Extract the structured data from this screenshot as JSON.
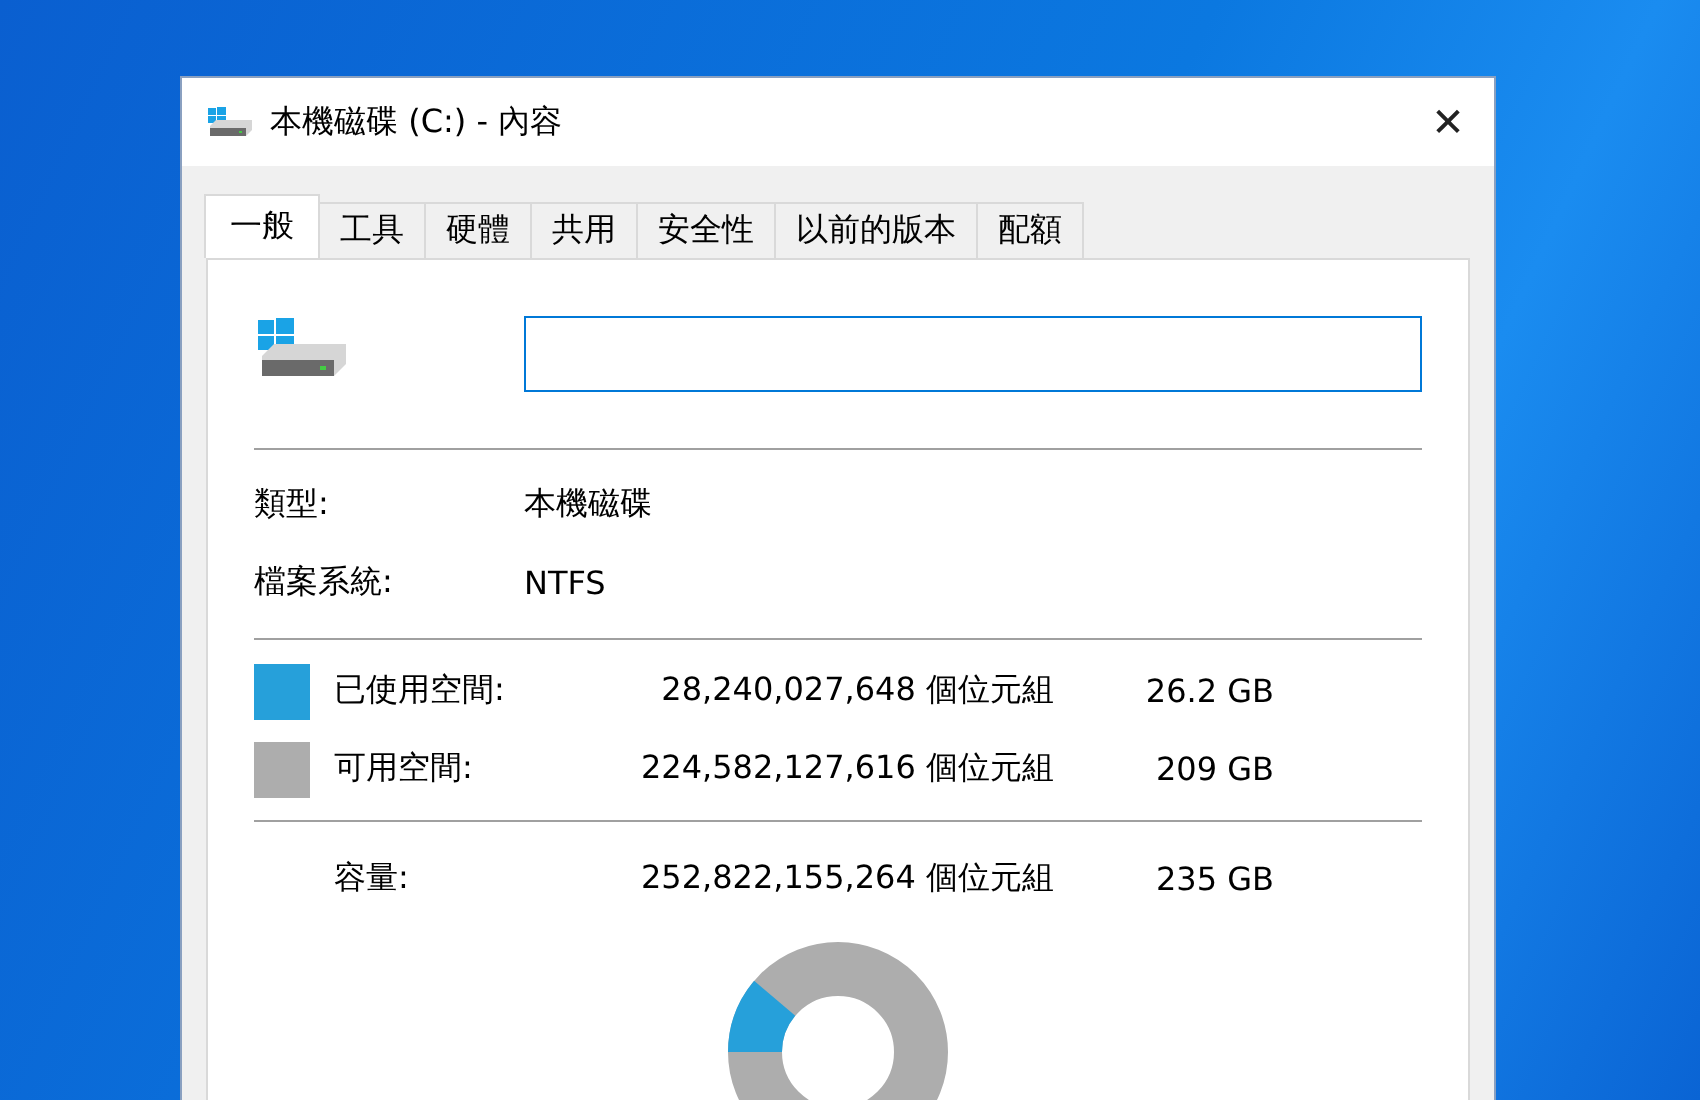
{
  "window": {
    "title": "本機磁碟 (C:) - 內容",
    "close": "✕"
  },
  "tabs": [
    {
      "label": "一般",
      "selected": true
    },
    {
      "label": "工具",
      "selected": false
    },
    {
      "label": "硬體",
      "selected": false
    },
    {
      "label": "共用",
      "selected": false
    },
    {
      "label": "安全性",
      "selected": false
    },
    {
      "label": "以前的版本",
      "selected": false
    },
    {
      "label": "配額",
      "selected": false
    }
  ],
  "info": [
    {
      "label": "類型:",
      "value": "本機磁碟"
    },
    {
      "label": "檔案系統:",
      "value": "NTFS"
    }
  ],
  "space": [
    {
      "label": "已使用空間:",
      "bytes": "28,240,027,648 個位元組",
      "size": "26.2 GB",
      "color": "#26a0da"
    },
    {
      "label": "可用空間:",
      "bytes": "224,582,127,616 個位元組",
      "size": "209 GB",
      "color": "#adadad"
    }
  ],
  "capacity": {
    "label": "容量:",
    "bytes": "252,822,155,264 個位元組",
    "size": "235 GB"
  }
}
